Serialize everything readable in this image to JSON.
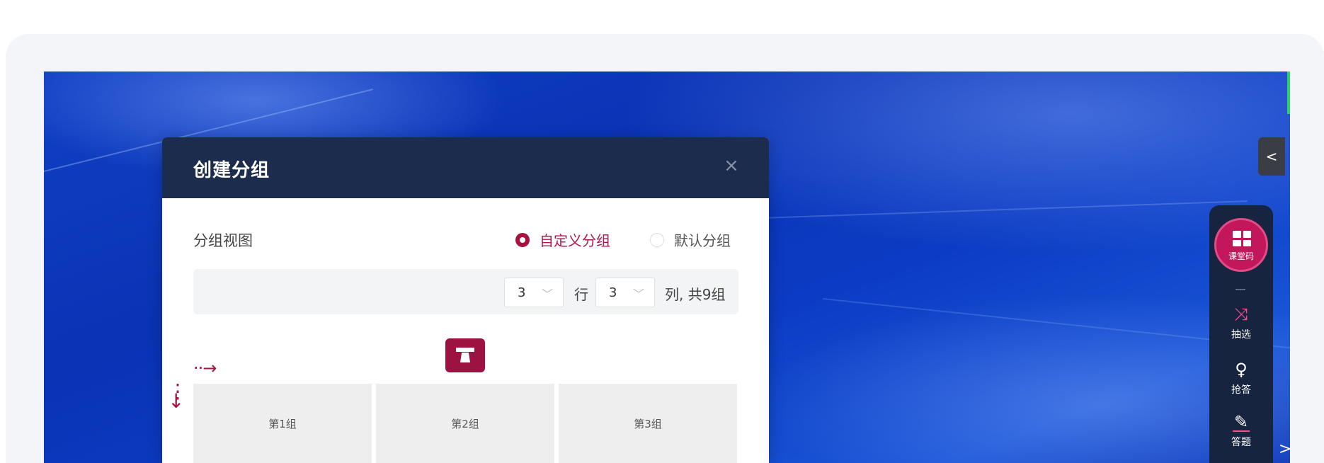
{
  "dialog": {
    "title": "创建分组",
    "close_glyph": "×",
    "view_label": "分组视图",
    "mode_options": [
      {
        "label": "自定义分组",
        "selected": true
      },
      {
        "label": "默认分组",
        "selected": false
      }
    ],
    "rows_value": "3",
    "row_unit": "行",
    "cols_value": "3",
    "col_summary": "列, 共9组",
    "groups": [
      "第1组",
      "第2组",
      "第3组"
    ],
    "arrow_right": "··→",
    "arrow_down": "⋮↓"
  },
  "toolbar": {
    "collapse_glyph": "<",
    "class_code_label": "课堂码",
    "items": [
      {
        "icon": "shuffle-icon",
        "glyph": "⤨",
        "label": "抽选"
      },
      {
        "icon": "answer-icon",
        "glyph": "ℬ",
        "label": "抢答"
      },
      {
        "icon": "pencil-icon",
        "glyph": "✎",
        "label": "答题"
      }
    ],
    "expand_glyph": ">"
  },
  "colors": {
    "accent": "#a8123f",
    "header": "#1c2c4c",
    "toolbar": "#16243f",
    "desktop": "#0b36b8"
  }
}
